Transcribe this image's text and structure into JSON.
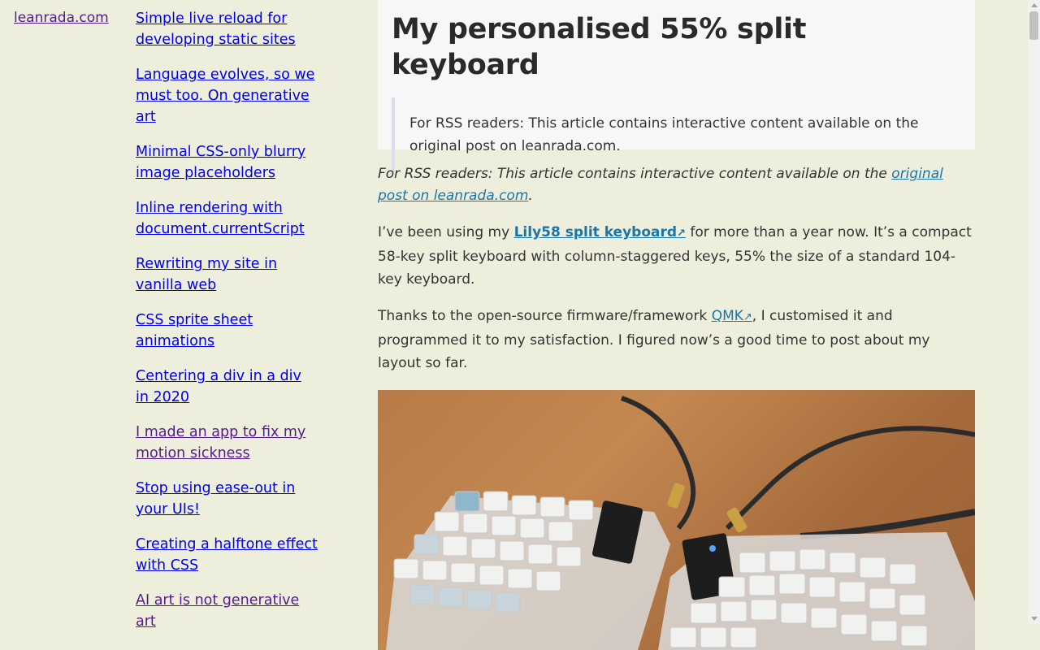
{
  "site": {
    "name": "leanrada.com"
  },
  "sidebar": {
    "items": [
      {
        "label": "Simple live reload for developing static sites",
        "visited": false
      },
      {
        "label": "Language evolves, so we must too. On generative art",
        "visited": false
      },
      {
        "label": "Minimal CSS-only blurry image placeholders",
        "visited": false
      },
      {
        "label": "Inline rendering with document.currentScript",
        "visited": false
      },
      {
        "label": "Rewriting my site in vanilla web",
        "visited": false
      },
      {
        "label": "CSS sprite sheet animations",
        "visited": false
      },
      {
        "label": "Centering a div in a div in 2020",
        "visited": false
      },
      {
        "label": "I made an app to fix my motion sickness",
        "visited": true
      },
      {
        "label": "Stop using ease-out in your UIs!",
        "visited": false
      },
      {
        "label": "Creating a halftone effect with CSS",
        "visited": false
      },
      {
        "label": "AI art is not generative art",
        "visited": true
      }
    ]
  },
  "article": {
    "title": "My personalised 55% split keyboard",
    "header_quote": "For RSS readers: This article contains interactive content available on the original post on leanrada.com.",
    "rss_notice": {
      "prefix": "For RSS readers: This article contains interactive content available on the ",
      "link": "original post on leanrada.com",
      "suffix": "."
    },
    "para1": {
      "prefix": "I’ve been using my ",
      "link": "Lily58 split keyboard",
      "suffix": " for more than a year now. It’s a compact 58-key split keyboard with column-staggered keys, 55% the size of a standard 104-key keyboard."
    },
    "para2": {
      "prefix": "Thanks to the open-source firmware/framework ",
      "link": "QMK",
      "suffix": ", I customised it and programmed it to my satisfaction. I figured now’s a good time to post about my layout so far."
    },
    "ext_icon": "external-link-arrow",
    "ext_glyph": "↗"
  },
  "colors": {
    "background": "#eeeedd",
    "link": "#0000ee",
    "visited": "#551a8b",
    "article_link": "#1976a8"
  }
}
